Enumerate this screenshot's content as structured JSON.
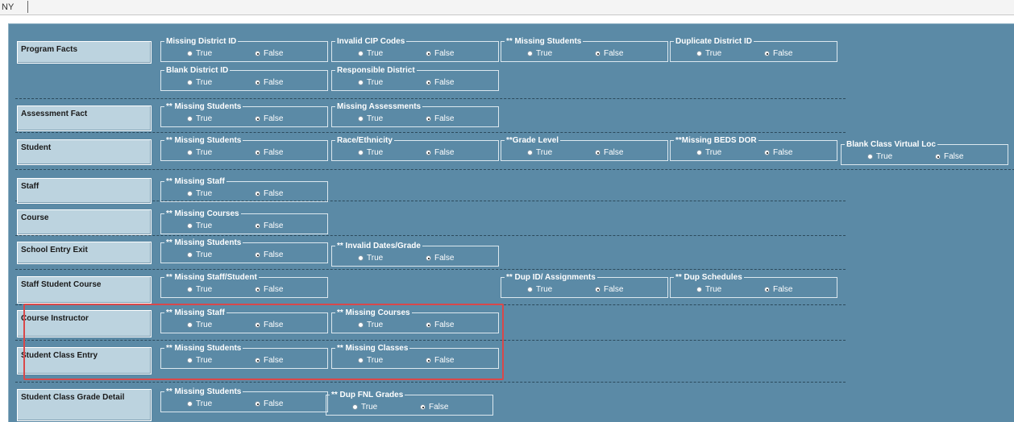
{
  "header": {
    "state_code": "NY"
  },
  "option_labels": {
    "true": "True",
    "false": "False"
  },
  "rows": [
    {
      "title": "Program Facts",
      "groups": [
        {
          "label": "Missing District ID",
          "selected": "False"
        },
        {
          "label": "Invalid CIP Codes",
          "selected": "False"
        },
        {
          "label": "** Missing Students",
          "selected": "False"
        },
        {
          "label": "Duplicate District ID",
          "selected": "False"
        },
        {
          "label": "Blank District ID",
          "selected": "False"
        },
        {
          "label": "Responsible District",
          "selected": "False"
        }
      ]
    },
    {
      "title": "Assessment Fact",
      "groups": [
        {
          "label": "** Missing Students",
          "selected": "False"
        },
        {
          "label": "Missing Assessments",
          "selected": "False"
        }
      ]
    },
    {
      "title": "Student",
      "groups": [
        {
          "label": "** Missing Students",
          "selected": "False"
        },
        {
          "label": "Race/Ethnicity",
          "selected": "False"
        },
        {
          "label": "**Grade Level",
          "selected": "False"
        },
        {
          "label": "**Missing BEDS DOR",
          "selected": "False"
        },
        {
          "label": "Blank Class Virtual Loc",
          "selected": "False"
        }
      ]
    },
    {
      "title": "Staff",
      "groups": [
        {
          "label": "** Missing Staff",
          "selected": "False"
        }
      ]
    },
    {
      "title": "Course",
      "groups": [
        {
          "label": "** Missing Courses",
          "selected": "False"
        }
      ]
    },
    {
      "title": "School Entry Exit",
      "groups": [
        {
          "label": "** Missing Students",
          "selected": "False"
        },
        {
          "label": "** Invalid Dates/Grade",
          "selected": "False"
        }
      ]
    },
    {
      "title": "Staff Student Course",
      "groups": [
        {
          "label": "** Missing Staff/Student",
          "selected": "False"
        },
        {
          "label": "** Dup ID/ Assignments",
          "selected": "False"
        },
        {
          "label": "** Dup Schedules",
          "selected": "False"
        }
      ]
    },
    {
      "title": "Course Instructor",
      "groups": [
        {
          "label": "** Missing Staff",
          "selected": "False"
        },
        {
          "label": "** Missing Courses",
          "selected": "False"
        }
      ]
    },
    {
      "title": "Student Class Entry",
      "groups": [
        {
          "label": "** Missing Students",
          "selected": "False"
        },
        {
          "label": "** Missing Classes",
          "selected": "False"
        }
      ]
    },
    {
      "title": "Student Class Grade Detail",
      "groups": [
        {
          "label": "** Missing Students",
          "selected": "False"
        },
        {
          "label": "** Dup FNL Grades",
          "selected": "False"
        }
      ]
    }
  ],
  "colors": {
    "canvas": "#5b8aa6",
    "section_box": "#bcd3df",
    "highlight": "#d9484a"
  }
}
